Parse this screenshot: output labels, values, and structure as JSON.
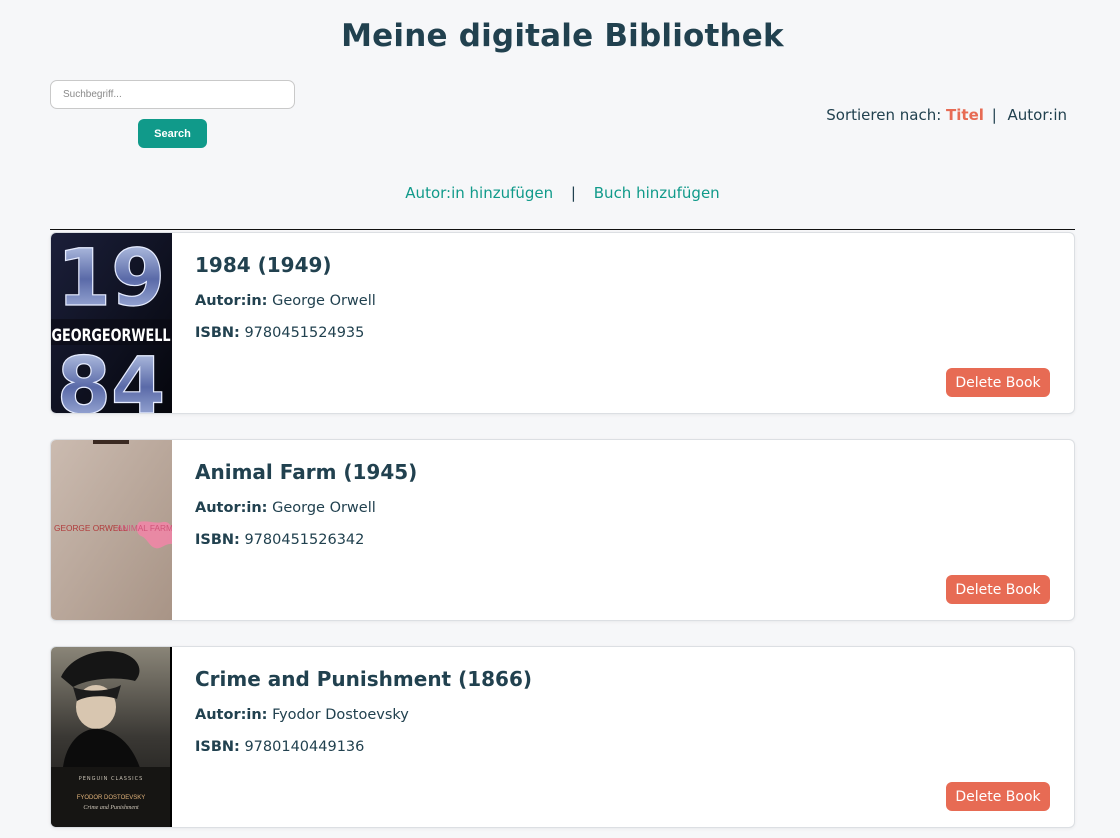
{
  "header": {
    "title": "Meine digitale Bibliothek"
  },
  "search": {
    "placeholder": "Suchbegriff...",
    "value": "",
    "button_label": "Search"
  },
  "sort": {
    "prefix": "Sortieren nach:",
    "options": [
      "Titel",
      "Autor:in"
    ],
    "active": "Titel",
    "separator": "|"
  },
  "actions": {
    "add_author": "Autor:in hinzufügen",
    "separator": "|",
    "add_book": "Buch hinzufügen"
  },
  "colors": {
    "title": "#21414f",
    "accent_teal": "#109a8a",
    "accent_coral": "#e76b54",
    "background": "#f6f7f9"
  },
  "books": [
    {
      "title": "1984 (1949)",
      "author_label": "Autor:in:",
      "author": "George Orwell",
      "isbn_label": "ISBN:",
      "isbn": "9780451524935",
      "delete_label": "Delete Book",
      "cover": {
        "line1": "19",
        "line2": "GEORGEORWELL",
        "line3": "84"
      }
    },
    {
      "title": "Animal Farm (1945)",
      "author_label": "Autor:in:",
      "author": "George Orwell",
      "isbn_label": "ISBN:",
      "isbn": "9780451526342",
      "delete_label": "Delete Book",
      "cover": {
        "author": "GEORGE ORWELL",
        "title": "ANIMAL FARM"
      }
    },
    {
      "title": "Crime and Punishment (1866)",
      "author_label": "Autor:in:",
      "author": "Fyodor Dostoevsky",
      "isbn_label": "ISBN:",
      "isbn": "9780140449136",
      "delete_label": "Delete Book",
      "cover": {
        "series": "PENGUIN CLASSICS",
        "author": "FYODOR DOSTOEVSKY",
        "title": "Crime and Punishment"
      }
    }
  ]
}
